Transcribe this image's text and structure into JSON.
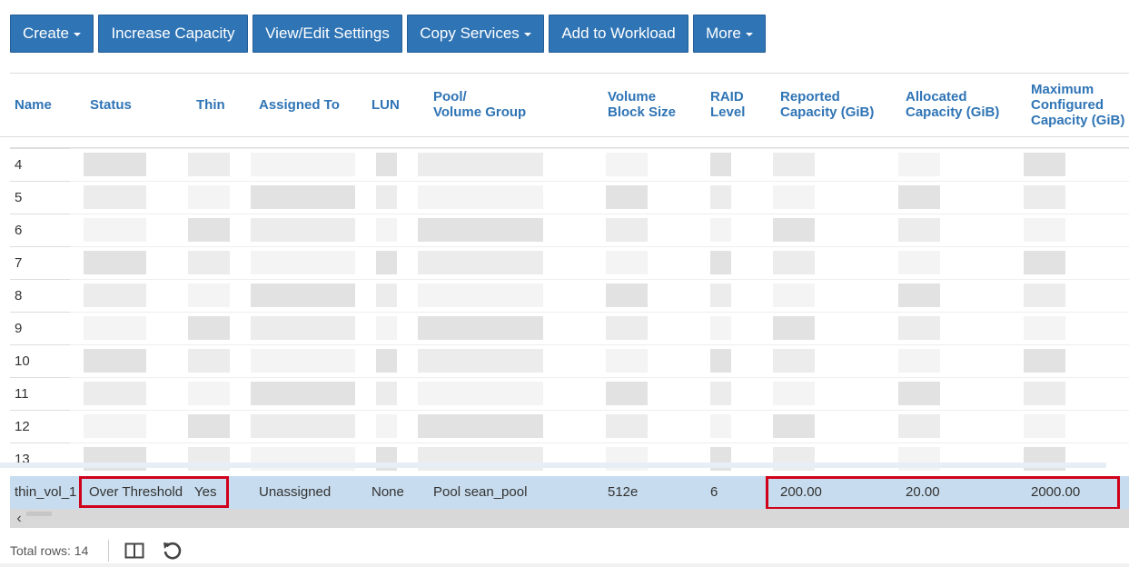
{
  "toolbar": {
    "buttons": [
      {
        "label": "Create",
        "dropdown": true
      },
      {
        "label": "Increase Capacity",
        "dropdown": false
      },
      {
        "label": "View/Edit Settings",
        "dropdown": false
      },
      {
        "label": "Copy Services",
        "dropdown": true
      },
      {
        "label": "Add to Workload",
        "dropdown": false
      },
      {
        "label": "More",
        "dropdown": true
      }
    ]
  },
  "table": {
    "columns": {
      "name": "Name",
      "status": "Status",
      "thin": "Thin",
      "assigned_to": "Assigned To",
      "lun": "LUN",
      "pool_line1": "Pool/",
      "pool_line2": "Volume Group",
      "block_line1": "Volume",
      "block_line2": "Block Size",
      "raid_line1": "RAID",
      "raid_line2": "Level",
      "reported_line1": "Reported",
      "reported_line2": "Capacity (GiB)",
      "allocated_line1": "Allocated",
      "allocated_line2": "Capacity (GiB)",
      "max_line1": "Maximum",
      "max_line2": "Configured",
      "max_line3": "Capacity (GiB)"
    },
    "obscured_rows": [
      "4",
      "5",
      "6",
      "7",
      "8",
      "9",
      "10",
      "11",
      "12",
      "13"
    ],
    "selected_row": {
      "name": "thin_vol_1",
      "status": "Over Threshold",
      "thin": "Yes",
      "assigned_to": "Unassigned",
      "lun": "None",
      "pool": "Pool sean_pool",
      "block_size": "512e",
      "raid_level": "6",
      "reported_capacity": "200.00",
      "allocated_capacity": "20.00",
      "max_configured_capacity": "2000.00"
    }
  },
  "footer": {
    "total_rows": "Total rows: 14"
  },
  "colors": {
    "button_bg": "#2f74b5",
    "header_text": "#2f74b5",
    "selected_row_bg": "#c7dcee",
    "highlight_box": "#d0021b"
  },
  "icons": [
    "caret-down-icon",
    "chevron-left-icon",
    "columns-icon",
    "refresh-icon"
  ]
}
